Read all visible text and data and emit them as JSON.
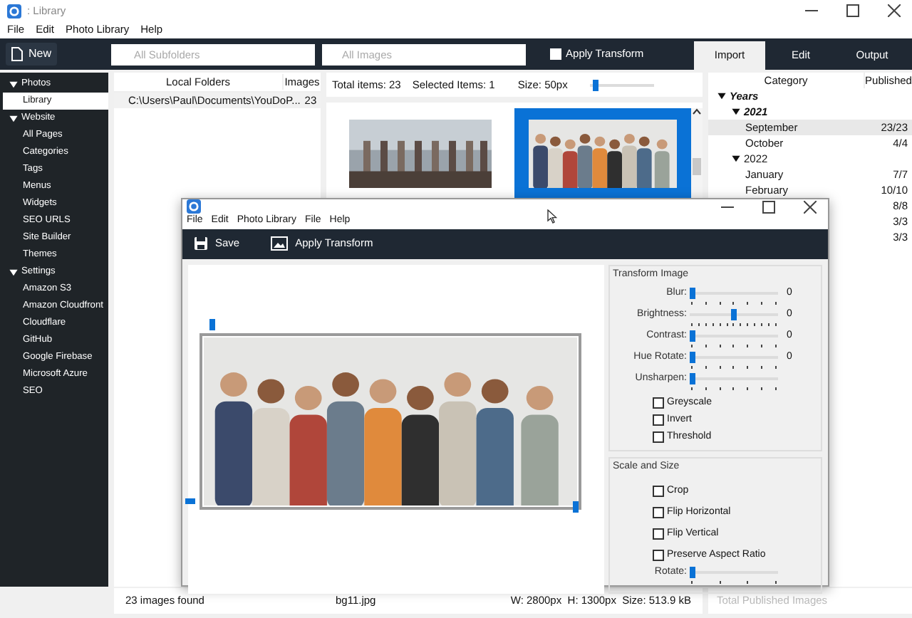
{
  "window": {
    "title": ": Library"
  },
  "menu": [
    "File",
    "Edit",
    "Photo Library",
    "Help"
  ],
  "toolbar": {
    "new_button": "New",
    "subfolders_field": {
      "placeholder": "All Subfolders"
    },
    "images_field": {
      "placeholder": "All Images"
    },
    "apply_transform": {
      "label": "Apply Transform",
      "checked": false
    }
  },
  "tabs": [
    {
      "label": "Import",
      "selected": true
    },
    {
      "label": "Edit",
      "selected": false
    },
    {
      "label": "Output",
      "selected": false
    }
  ],
  "sidebar": {
    "items": [
      {
        "label": "Photos",
        "expanded": true,
        "selected": false,
        "children": [
          {
            "label": "Library",
            "selected": true
          }
        ]
      },
      {
        "label": "Website",
        "expanded": true,
        "selected": false,
        "children": [
          {
            "label": "All Pages",
            "selected": false
          },
          {
            "label": "Categories",
            "selected": false
          },
          {
            "label": "Tags",
            "selected": false
          },
          {
            "label": "Menus",
            "selected": false
          },
          {
            "label": "Widgets",
            "selected": false
          },
          {
            "label": "SEO URLS",
            "selected": false
          },
          {
            "label": "Site Builder",
            "selected": false
          },
          {
            "label": "Themes",
            "selected": false
          }
        ]
      },
      {
        "label": "Settings",
        "expanded": true,
        "selected": false,
        "children": [
          {
            "label": "Amazon S3",
            "selected": false
          },
          {
            "label": "Amazon Cloudfront",
            "selected": false
          },
          {
            "label": "Cloudflare",
            "selected": false
          },
          {
            "label": "GitHub",
            "selected": false
          },
          {
            "label": "Google Firebase",
            "selected": false
          },
          {
            "label": "Microsoft Azure",
            "selected": false
          },
          {
            "label": "SEO",
            "selected": false
          }
        ]
      }
    ]
  },
  "folders": {
    "columns": [
      "Local Folders",
      "Images"
    ],
    "rows": [
      [
        "C:\\Users\\Paul\\Documents\\YouDoP...",
        "23"
      ]
    ]
  },
  "gallery": {
    "total": "Total items: 23",
    "selected_count": "Selected Items: 1",
    "size": "Size: 50px",
    "size_slider": {
      "level": 0.04
    },
    "thumbnails": [
      {
        "selected": false
      },
      {
        "selected": true
      }
    ]
  },
  "category_tree": {
    "columns": [
      "Category",
      "Published"
    ],
    "items": [
      {
        "label": "Years",
        "bold": true,
        "expanded": true,
        "selected": false,
        "children": [
          {
            "label": "2021",
            "bold": true,
            "expanded": true,
            "selected": false,
            "children": [
              {
                "label": "September",
                "published": "23/23",
                "bold": false,
                "selected": true
              },
              {
                "label": "October",
                "published": "4/4",
                "bold": false,
                "selected": false
              }
            ]
          },
          {
            "label": "2022",
            "bold": false,
            "expanded": true,
            "selected": false,
            "children": [
              {
                "label": "January",
                "published": "7/7",
                "bold": false,
                "selected": false
              },
              {
                "label": "February",
                "published": "10/10",
                "bold": false,
                "selected": false
              },
              {
                "published": "8/8",
                "selected": false
              },
              {
                "published": "3/3",
                "selected": false
              },
              {
                "published": "3/3",
                "selected": false
              }
            ]
          }
        ]
      }
    ]
  },
  "status_bar": {
    "count": "23 images found",
    "file": "bg11.jpg",
    "dimensions": "W: 2800px  H: 1300px  Size: 513.9 kB",
    "total_published": "Total Published Images"
  },
  "dialog": {
    "menu": [
      "File",
      "Edit",
      "Photo Library",
      "File",
      "Help"
    ],
    "toolbar": [
      {
        "kind": "save",
        "label": "Save"
      },
      {
        "kind": "image",
        "label": "Apply Transform"
      }
    ],
    "transform_image": {
      "title": "Transform Image",
      "sliders": [
        {
          "label": "Blur:",
          "level": 0,
          "reading": "0"
        },
        {
          "label": "Brightness:",
          "level": 0.5,
          "reading": "0"
        },
        {
          "label": "Contrast:",
          "level": 0,
          "reading": "0"
        },
        {
          "label": "Hue Rotate:",
          "level": 0,
          "reading": "0"
        },
        {
          "label": "Unsharpen:",
          "level": 0
        }
      ],
      "checkboxes": [
        {
          "label": "Greyscale",
          "checked": false
        },
        {
          "label": "Invert",
          "checked": false
        },
        {
          "label": "Threshold",
          "checked": false
        }
      ]
    },
    "scale_and_size": {
      "title": "Scale and Size",
      "checkboxes": [
        {
          "label": "Crop",
          "checked": false
        },
        {
          "label": "Flip Horizontal",
          "checked": false
        },
        {
          "label": "Flip Vertical",
          "checked": false
        },
        {
          "label": "Preserve Aspect Ratio",
          "checked": false
        }
      ],
      "sliders": [
        {
          "label": "Rotate:",
          "level": 0
        }
      ]
    }
  }
}
